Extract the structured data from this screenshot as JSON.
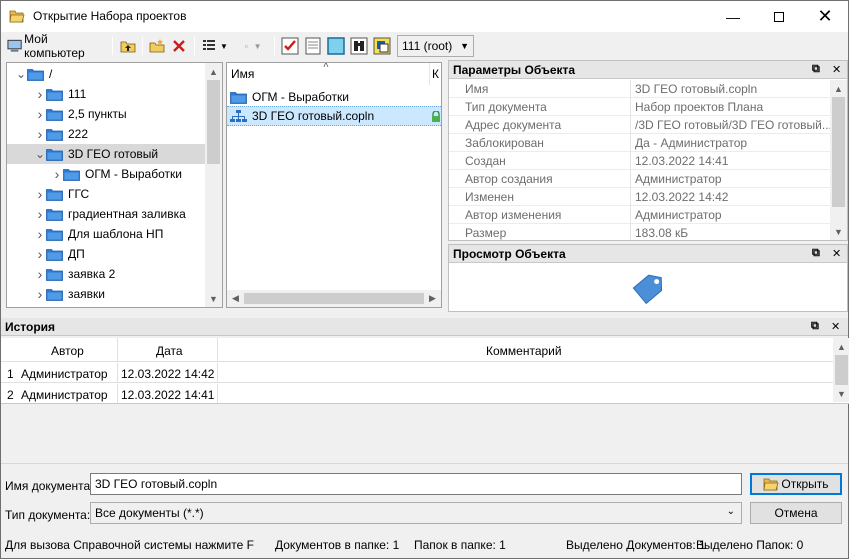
{
  "window": {
    "title": "Открытие Набора проектов"
  },
  "toolbar": {
    "my_computer": "Мой компьютер",
    "root_combo": "111 (root)"
  },
  "tree": {
    "root": "/",
    "items": [
      "111",
      "2,5 пункты",
      "222",
      "3D ГЕО готовый",
      "ОГМ - Выработки",
      "ГГС",
      "градиентная заливка",
      "Для шаблона НП",
      "ДП",
      "заявка 2",
      "заявки"
    ]
  },
  "list": {
    "col_name": "Имя",
    "col_k": "К",
    "items": [
      "ОГМ - Выработки",
      "3D ГЕО готовый.copln"
    ]
  },
  "params": {
    "caption": "Параметры Объекта",
    "rows": [
      {
        "k": "Имя",
        "v": "3D ГЕО готовый.copln"
      },
      {
        "k": "Тип документа",
        "v": "Набор проектов Плана"
      },
      {
        "k": "Адрес документа",
        "v": "/3D ГЕО готовый/3D ГЕО готовый..."
      },
      {
        "k": "Заблокирован",
        "v": "Да - Администратор"
      },
      {
        "k": "Создан",
        "v": "12.03.2022 14:41"
      },
      {
        "k": "Автор создания",
        "v": "Администратор"
      },
      {
        "k": "Изменен",
        "v": "12.03.2022 14:42"
      },
      {
        "k": "Автор изменения",
        "v": "Администратор"
      },
      {
        "k": "Размер",
        "v": "183.08 кБ"
      }
    ]
  },
  "preview": {
    "caption": "Просмотр Объекта"
  },
  "history": {
    "caption": "История",
    "col_author": "Автор",
    "col_date": "Дата",
    "col_comment": "Комментарий",
    "rows": [
      {
        "n": "1",
        "author": "Администратор",
        "date": "12.03.2022 14:42"
      },
      {
        "n": "2",
        "author": "Администратор",
        "date": "12.03.2022 14:41"
      }
    ]
  },
  "form": {
    "doc_name_label": "Имя документа:",
    "doc_name_value": "3D ГЕО готовый.copln",
    "doc_type_label": "Тип документа:",
    "doc_type_value": "Все документы (*.*)",
    "open_btn": "Открыть",
    "cancel_btn": "Отмена"
  },
  "statusbar": {
    "help": "Для вызова Справочной системы нажмите F",
    "docs": "Документов в папке: 1",
    "folders": "Папок в папке: 1",
    "sel_docs": "Выделено Документов: 1",
    "sel_folders": "Выделено Папок: 0"
  },
  "colors": {
    "folder": "#2d7ad6",
    "selection": "#cce8ff",
    "accent": "#0078d7"
  }
}
